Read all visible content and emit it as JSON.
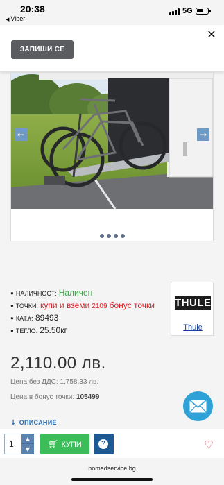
{
  "status_bar": {
    "time": "20:38",
    "back_app": "Viber",
    "network": "5G"
  },
  "header": {
    "signup_label": "ЗАПИШИ СЕ",
    "close_icon": "close-icon"
  },
  "gallery": {
    "image_icon": "bike-rack-photo",
    "prev_icon": "arrow-left-icon",
    "next_icon": "arrow-right-icon",
    "slide_count": 4
  },
  "details": {
    "availability_label": "НАЛИЧНОСТ:",
    "availability_value": "Наличен",
    "points_label": "ТОЧКИ:",
    "points_text": "купи и вземи",
    "points_value": "2109",
    "points_suffix": "бонус точки",
    "catalog_label": "КАТ.#:",
    "catalog_value": "89493",
    "weight_label": "ТЕГЛО:",
    "weight_value": "25.50кг"
  },
  "brand": {
    "logo_text": "THULE",
    "link_label": "Thule"
  },
  "pricing": {
    "price": "2,110.00 лв.",
    "price_no_vat": "Цена без ДДС: 1,758.33 лв.",
    "bonus_label": "Цена в бонус точки:",
    "bonus_value": "105499"
  },
  "description": {
    "label": "ОПИСАНИЕ"
  },
  "buy_bar": {
    "quantity": "1",
    "buy_label": "КУПИ",
    "help_label": "?"
  },
  "browser": {
    "url": "nomadservice.bg"
  },
  "colors": {
    "available": "#3aa547",
    "points": "#e02020",
    "buy_button": "#3bbd5a",
    "help_button": "#1d5a94",
    "mail_fab": "#2ea2d6"
  }
}
